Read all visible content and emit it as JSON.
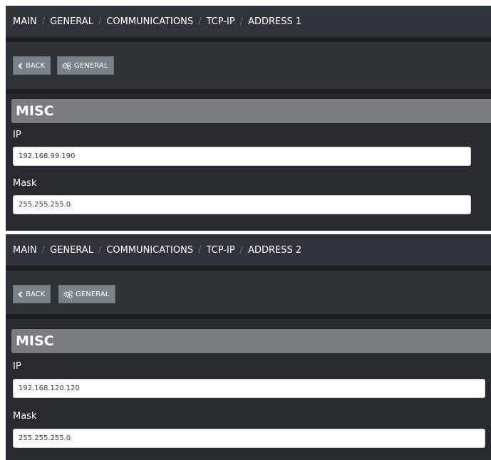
{
  "panels": [
    {
      "breadcrumb": [
        "MAIN",
        "GENERAL",
        "COMMUNICATIONS",
        "TCP-IP",
        "ADDRESS 1"
      ],
      "separator": "/",
      "toolbar": {
        "back_label": "BACK",
        "general_label": "GENERAL"
      },
      "section": {
        "title": "MISC",
        "ip_label": "IP",
        "ip_value": "192.168.99.190",
        "mask_label": "Mask",
        "mask_value": "255.255.255.0"
      }
    },
    {
      "breadcrumb": [
        "MAIN",
        "GENERAL",
        "COMMUNICATIONS",
        "TCP-IP",
        "ADDRESS 2"
      ],
      "separator": "/",
      "toolbar": {
        "back_label": "BACK",
        "general_label": "GENERAL"
      },
      "section": {
        "title": "MISC",
        "ip_label": "IP",
        "ip_value": "192.168.120.120",
        "mask_label": "Mask",
        "mask_value": "255.255.255.0"
      }
    }
  ],
  "icons": {
    "back": "chevron-left-icon",
    "general": "cogs-icon"
  },
  "colors": {
    "panel_bg": "#272b30",
    "breadcrumb_bg": "#2f343a",
    "button_bg": "#7a8288",
    "section_header_bg": "#7a7d80"
  }
}
